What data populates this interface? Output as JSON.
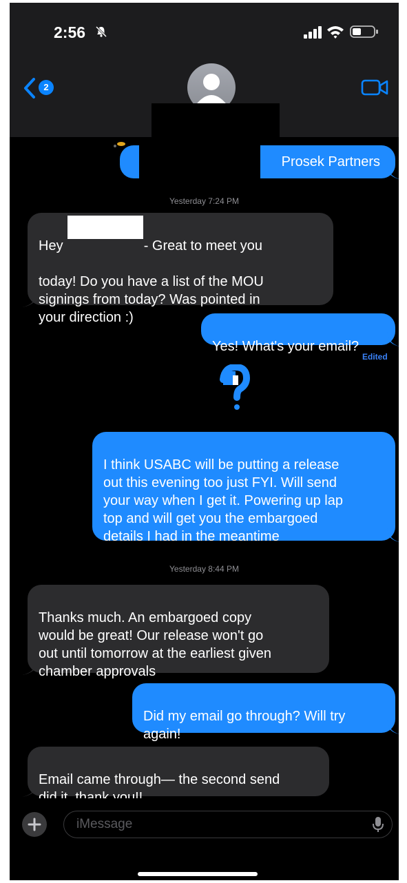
{
  "status_bar": {
    "time": "2:56"
  },
  "header": {
    "back_badge": "2"
  },
  "messages": {
    "first_sent": "Prosek Partners",
    "timestamp_1": "Yesterday 7:24 PM",
    "msg1_part1": "Hey",
    "msg1_part2": "- Great to meet you",
    "msg1_rest": "today! Do you have a list of the MOU\nsignings from today? Was pointed in\nyour direction :)",
    "msg2": "Yes! What's your email?",
    "msg2_status": "Edited",
    "msg3": "I think USABC will be putting a release\nout this evening too just FYI. Will send\nyour way when I get it. Powering up lap\ntop and will get you the embargoed\ndetails I had in the meantime",
    "timestamp_2": "Yesterday 8:44 PM",
    "msg4": "Thanks much. An embargoed copy\nwould be great! Our release won't go\nout until tomorrow at the earliest given\nchamber approvals",
    "msg5": "Did my email go through? Will try\nagain!",
    "msg6": "Email came through— the second send\ndid it, thank you!!"
  },
  "input_bar": {
    "placeholder": "iMessage"
  },
  "colors": {
    "sent_bubble": "#1f8bff",
    "received_bubble": "#2c2c2e",
    "accent": "#0a84ff"
  }
}
